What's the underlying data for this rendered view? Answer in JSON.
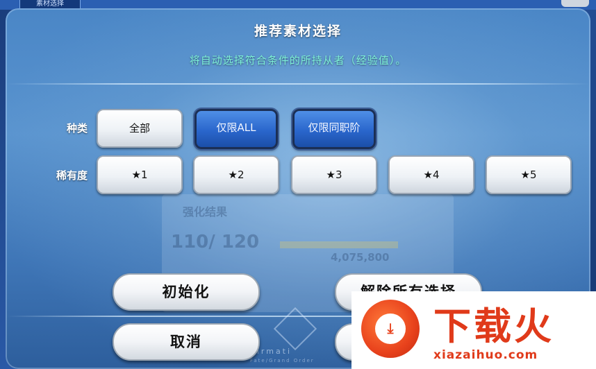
{
  "top_bar": {
    "tab_label": "素材选择"
  },
  "dialog": {
    "title": "推荐素材选择",
    "subtitle": "将自动选择符合条件的所持从者（经验值）。",
    "type_row": {
      "label": "种类",
      "options": [
        {
          "label": "全部",
          "selected": false
        },
        {
          "label": "仅限ALL",
          "selected": true
        },
        {
          "label": "仅限同职阶",
          "selected": true
        }
      ]
    },
    "rarity_row": {
      "label": "稀有度",
      "options": [
        {
          "label": "★1"
        },
        {
          "label": "★2"
        },
        {
          "label": "★3"
        },
        {
          "label": "★4"
        },
        {
          "label": "★5"
        }
      ]
    },
    "buttons": {
      "reset": "初始化",
      "clear_all": "解除所有选择",
      "cancel": "取消"
    }
  },
  "background": {
    "ghost_text_1": "强化结果",
    "ghost_text_2": "110/ 120",
    "ghost_text_3": "4,075,800",
    "footer_text": "nfirmati",
    "footer_sub": "Fate/Grand Order"
  },
  "watermark": {
    "title": "下载火",
    "url": "xiazaihuo.com"
  },
  "colors": {
    "accent_selected": "#2a66cc",
    "subtitle": "#7ef2d8",
    "watermark": "#e03a1a"
  }
}
